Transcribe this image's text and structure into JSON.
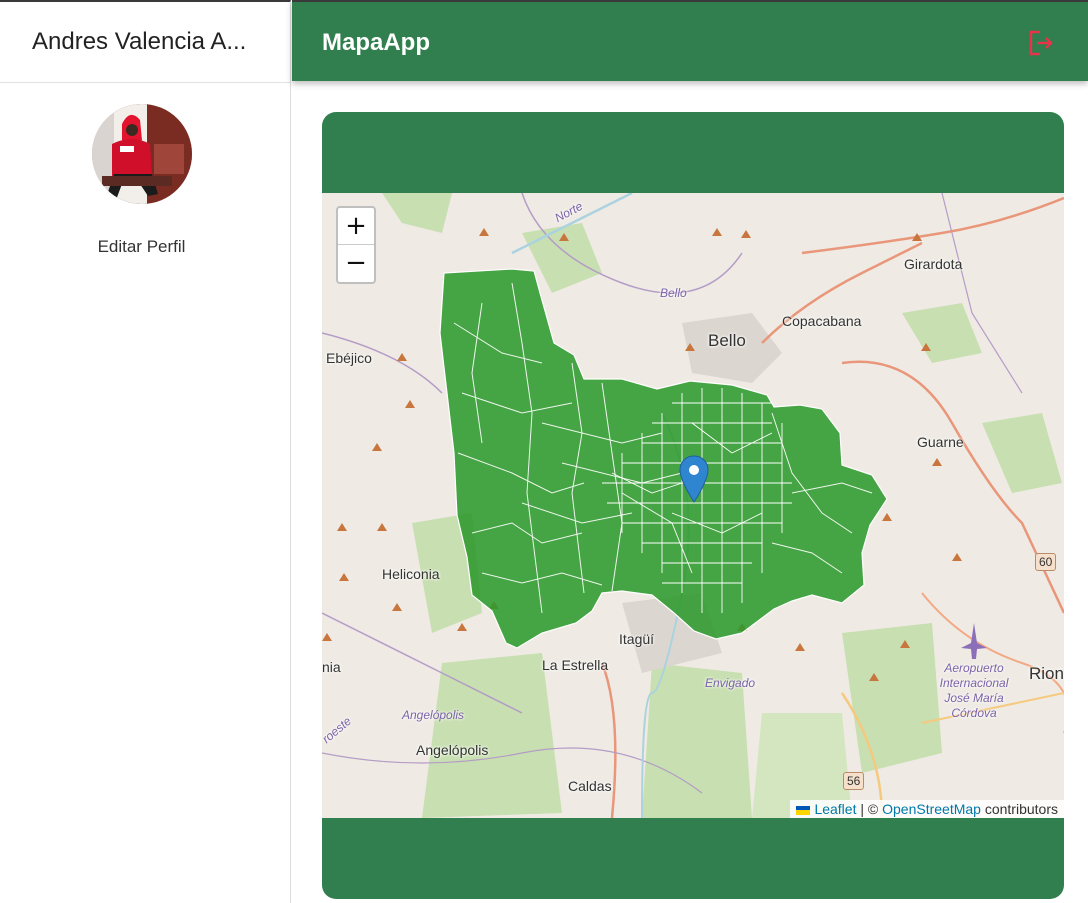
{
  "sidebar": {
    "user_name": "Andres Valencia A...",
    "edit_profile": "Editar Perfil"
  },
  "topbar": {
    "title": "MapaApp",
    "logout_icon": "logout-icon"
  },
  "map": {
    "zoom_in": "+",
    "zoom_out": "−",
    "places": {
      "bello": "Bello",
      "copacabana": "Copacabana",
      "girardota": "Girardota",
      "ebejico": "Ebéjico",
      "guarne": "Guarne",
      "heliconia": "Heliconia",
      "itagui": "Itagüí",
      "la_estrella": "La Estrella",
      "envigado": "Envigado",
      "angelopolis_area": "Angelópolis",
      "angelopolis": "Angelópolis",
      "caldas": "Caldas",
      "rionegro_partial": "Rion",
      "armenia_partial": "nia",
      "norte": "Norte",
      "bello_river": "Bello",
      "oeste_partial": "roeste",
      "airport": "Aeropuerto Internacional José María Córdova"
    },
    "road_shields": [
      "60",
      "56"
    ],
    "attribution": {
      "leaflet": "Leaflet",
      "separator": "| ©",
      "osm": "OpenStreetMap",
      "contributors": "contributors"
    },
    "colors": {
      "region_fill": "#2e9a2c",
      "header": "#317f4e"
    }
  }
}
